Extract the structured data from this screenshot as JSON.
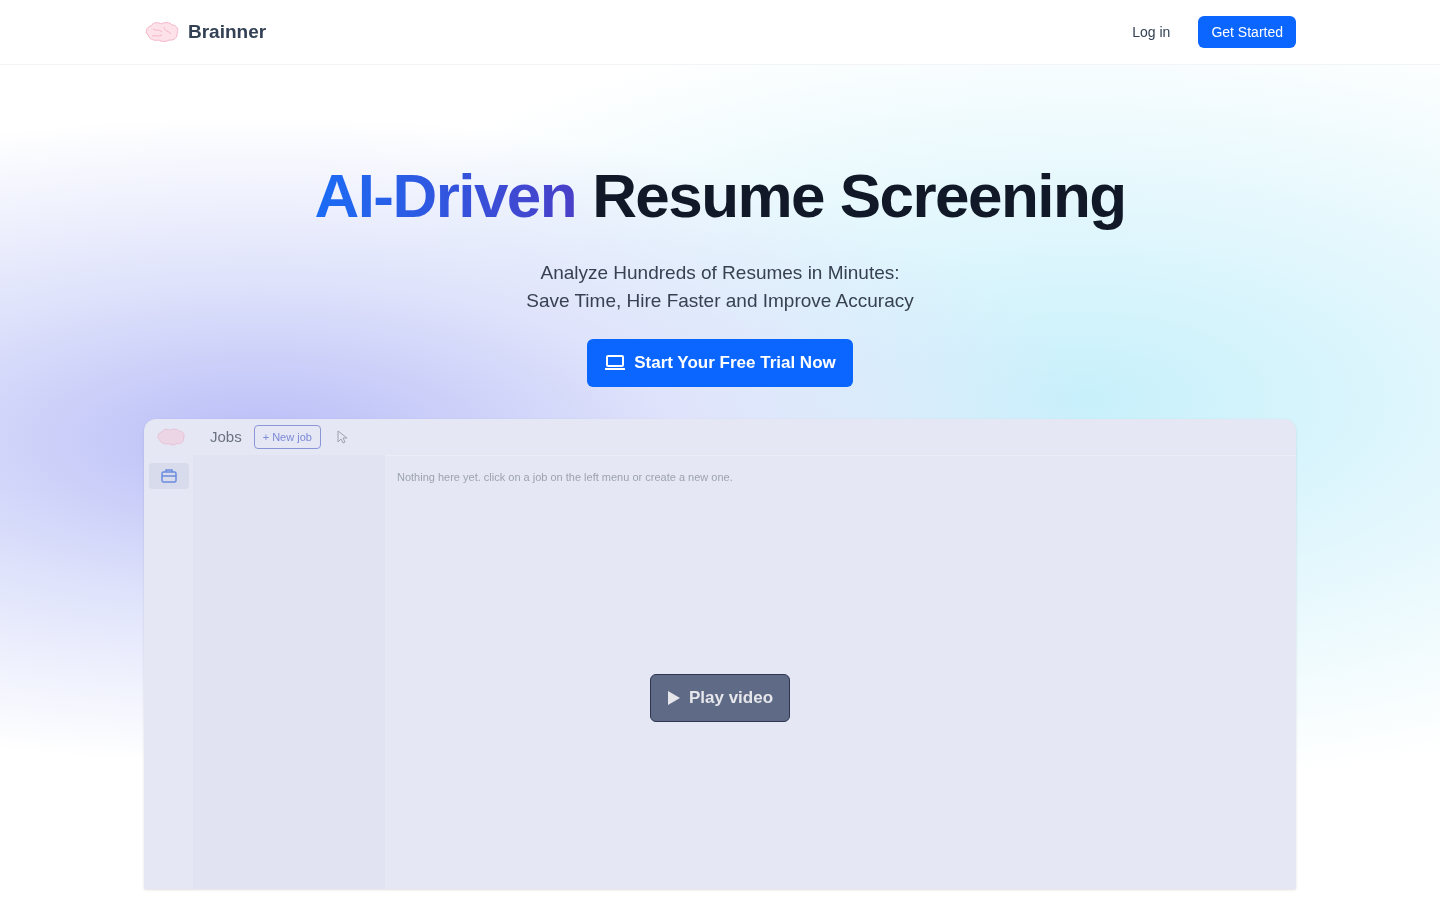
{
  "header": {
    "brand": "Brainner",
    "links": [
      {
        "label": "Log in",
        "kind": "link"
      },
      {
        "label": "Get Started",
        "kind": "button"
      }
    ]
  },
  "hero": {
    "title_highlight": "AI-Driven",
    "title_rest": "Resume Screening",
    "subtitle_lines": [
      "Analyze Hundreds of Resumes in Minutes:",
      "Save Time, Hire Faster and Improve Accuracy"
    ],
    "cta": "Start Your Free Trial Now"
  },
  "video_preview": {
    "app": {
      "title": "Jobs",
      "new_button": "+ New job",
      "empty_message": "Nothing here yet. click on a job on the left menu or create a new one."
    },
    "play_button": "Play video"
  }
}
